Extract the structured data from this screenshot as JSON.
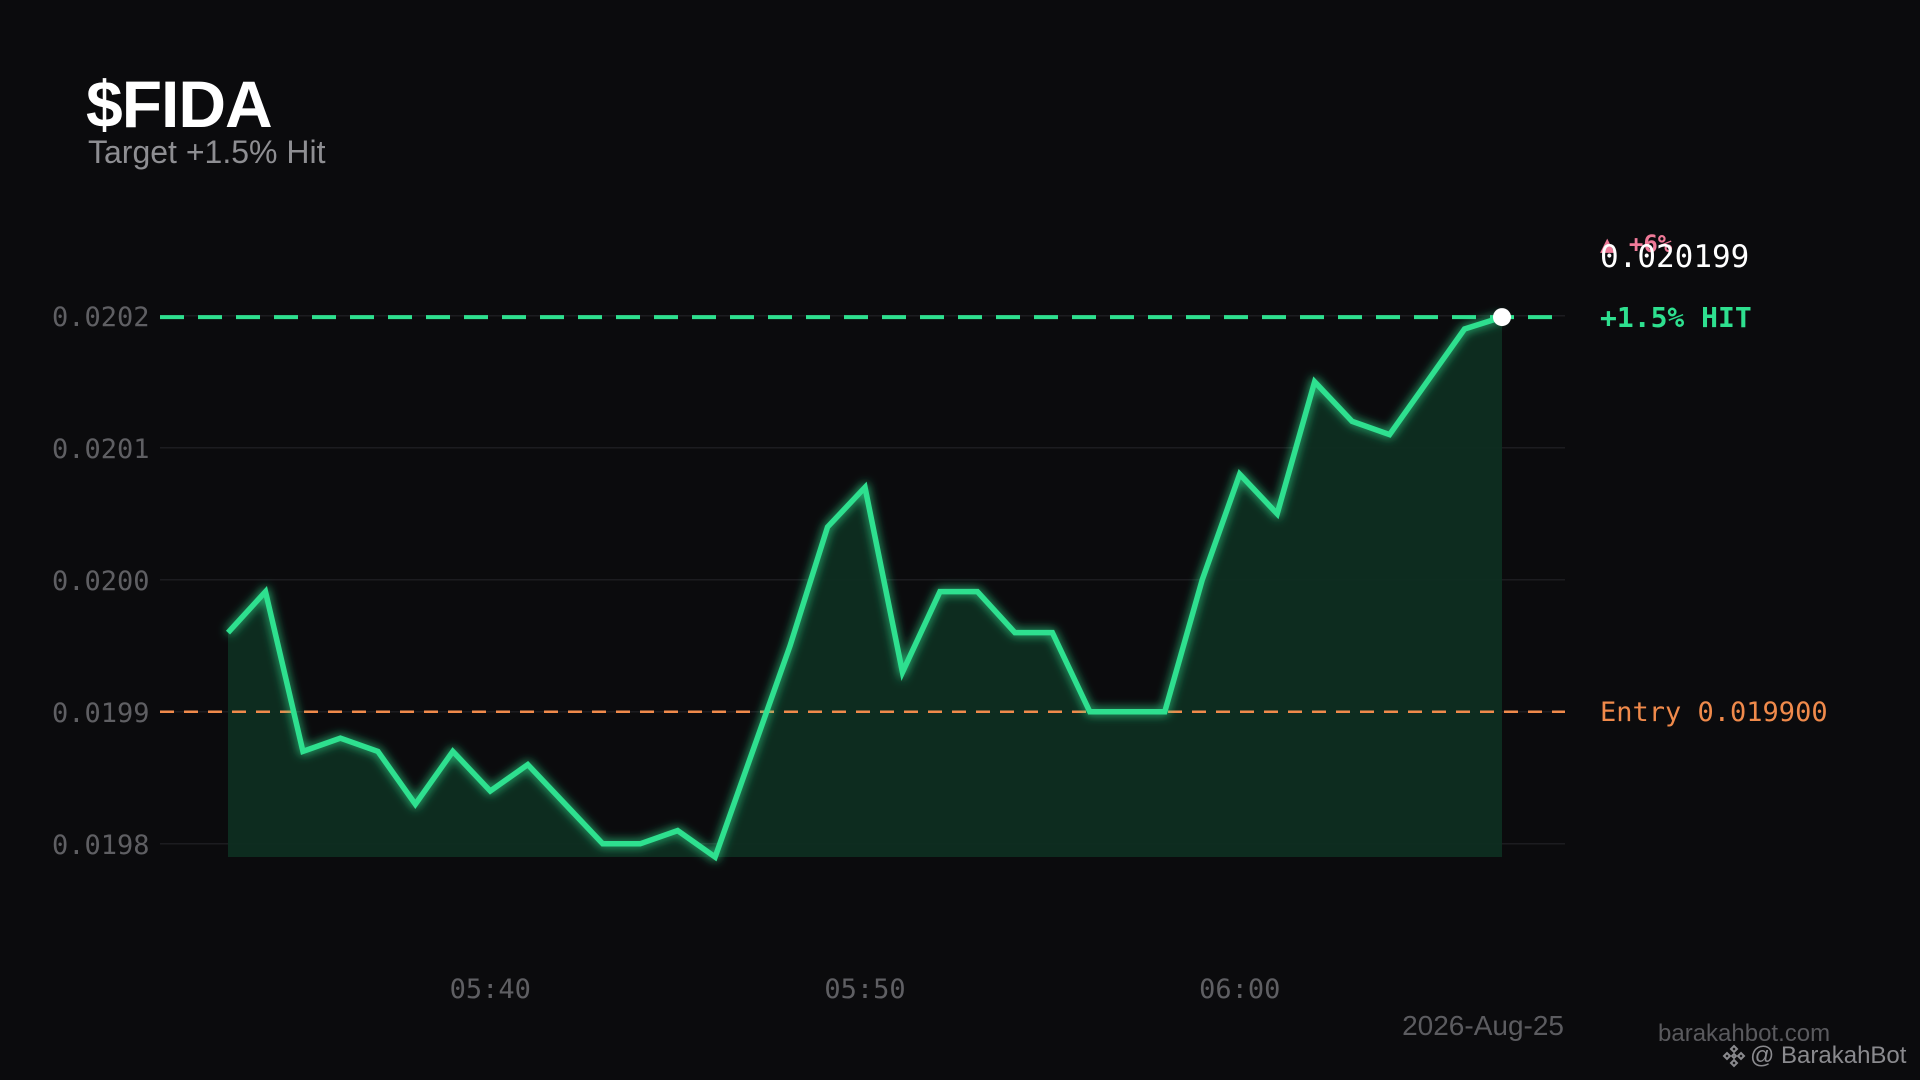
{
  "header": {
    "title": "$FIDA",
    "subtitle": "Target +1.5% Hit"
  },
  "labels": {
    "price": "0.020199",
    "change": "▲ +6%",
    "target": "+1.5%  HIT",
    "entry": "Entry 0.019900",
    "date": "2026-Aug-25",
    "site": "barakahbot.com",
    "handle": "@ BarakahBot"
  },
  "colors": {
    "line": "#2ee08f",
    "fill": "#0e2e21",
    "target": "#2ee08f",
    "entry": "#f08a4b",
    "change": "#f07a98",
    "grid": "#1c1c20",
    "tick": "#5f5f63"
  },
  "chart_data": {
    "type": "area",
    "title": "$FIDA",
    "subtitle": "Target +1.5% Hit",
    "x": [
      "05:33",
      "05:34",
      "05:35",
      "05:36",
      "05:37",
      "05:38",
      "05:39",
      "05:40",
      "05:41",
      "05:42",
      "05:43",
      "05:44",
      "05:45",
      "05:46",
      "05:47",
      "05:48",
      "05:49",
      "05:50",
      "05:51",
      "05:52",
      "05:53",
      "05:54",
      "05:55",
      "05:56",
      "05:57",
      "05:58",
      "05:59",
      "06:00",
      "06:01",
      "06:02",
      "06:03",
      "06:04",
      "06:05",
      "06:06",
      "06:07"
    ],
    "values": [
      0.01996,
      0.019991,
      0.01987,
      0.01988,
      0.01987,
      0.01983,
      0.01987,
      0.01984,
      0.01986,
      0.01983,
      0.0198,
      0.0198,
      0.01981,
      0.01979,
      0.01987,
      0.01995,
      0.02004,
      0.02007,
      0.01993,
      0.019991,
      0.019991,
      0.01996,
      0.01996,
      0.0199,
      0.0199,
      0.0199,
      0.02,
      0.02008,
      0.02005,
      0.02015,
      0.02012,
      0.02011,
      0.02015,
      0.02019,
      0.020199
    ],
    "ylim": [
      0.019765,
      0.020265
    ],
    "yticks": [
      "0.0198",
      "0.0199",
      "0.0200",
      "0.0201",
      "0.0202"
    ],
    "xticks": [
      "05:40",
      "05:50",
      "06:00"
    ],
    "reference_lines": [
      {
        "name": "target",
        "value": 0.020199,
        "label": "+1.5%  HIT"
      },
      {
        "name": "entry",
        "value": 0.0199,
        "label": "Entry 0.019900"
      }
    ],
    "grid": true
  }
}
